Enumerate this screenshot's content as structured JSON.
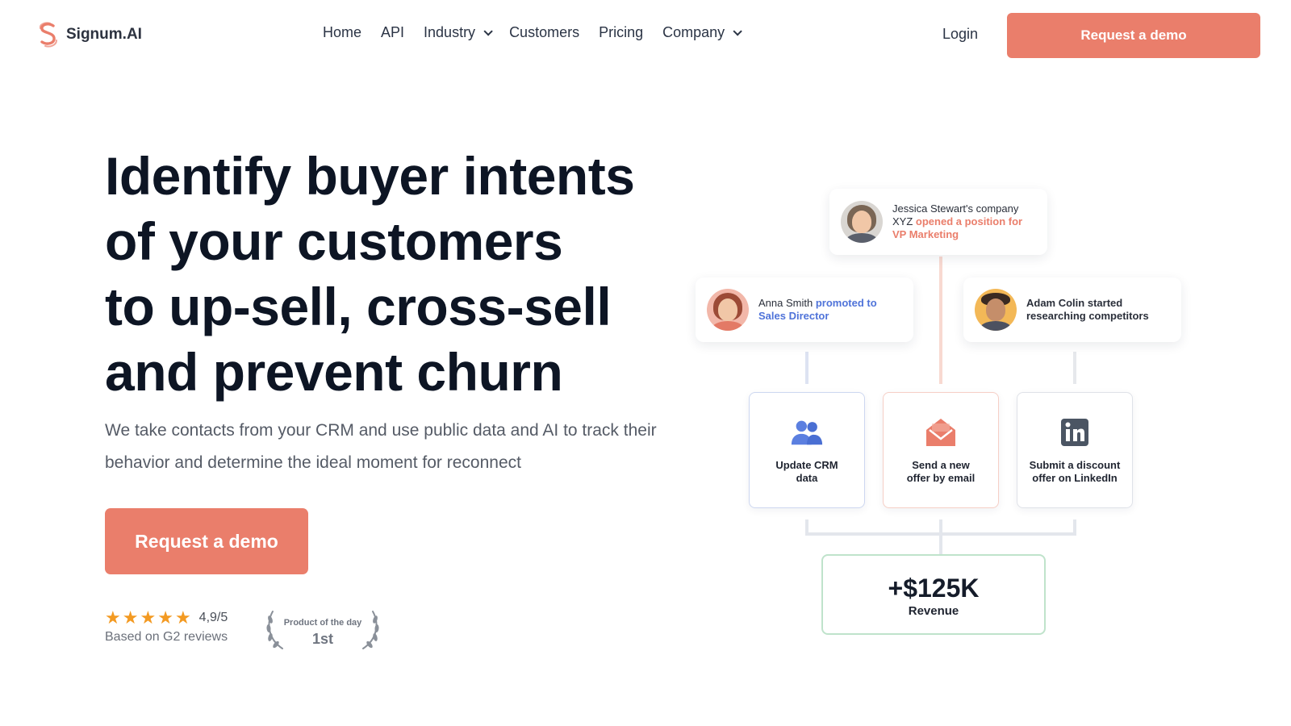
{
  "brand": {
    "name": "Signum.AI",
    "accent": "#ea7e6b"
  },
  "nav": {
    "items": [
      {
        "label": "Home",
        "dropdown": false
      },
      {
        "label": "API",
        "dropdown": false
      },
      {
        "label": "Industry",
        "dropdown": true
      },
      {
        "label": "Customers",
        "dropdown": false
      },
      {
        "label": "Pricing",
        "dropdown": false
      },
      {
        "label": "Company",
        "dropdown": true
      }
    ],
    "login": "Login",
    "cta": "Request a demo"
  },
  "hero": {
    "title_lines": [
      "Identify buyer intents",
      "of your customers",
      "to up-sell, cross-sell",
      "and prevent churn"
    ],
    "subtitle": "We take contacts from your CRM and use public data and AI to track their behavior and determine the ideal moment for reconnect",
    "cta": "Request a demo"
  },
  "rating": {
    "stars": 5,
    "score": "4,9/5",
    "note": "Based on G2 reviews"
  },
  "award": {
    "title": "Product of the day",
    "rank": "1st"
  },
  "diagram": {
    "signals": {
      "jessica": {
        "lead": "Jessica Stewart's company XYZ",
        "highlight": "opened a position for VP Marketing"
      },
      "anna": {
        "lead": "Anna Smith",
        "highlight": "promoted to Sales Director"
      },
      "adam": {
        "lead": "Adam Colin",
        "highlight": "started researching competitors"
      }
    },
    "actions": {
      "crm": "Update CRM data",
      "email": "Send a new offer by email",
      "linkedin": "Submit a discount offer on LinkedIn"
    },
    "revenue": {
      "amount": "+$125K",
      "label": "Revenue"
    }
  },
  "colors": {
    "accent": "#ea7e6b",
    "blue_highlight": "#4f73d9",
    "star": "#f39a22",
    "revenue_border": "#bfe3cb"
  }
}
